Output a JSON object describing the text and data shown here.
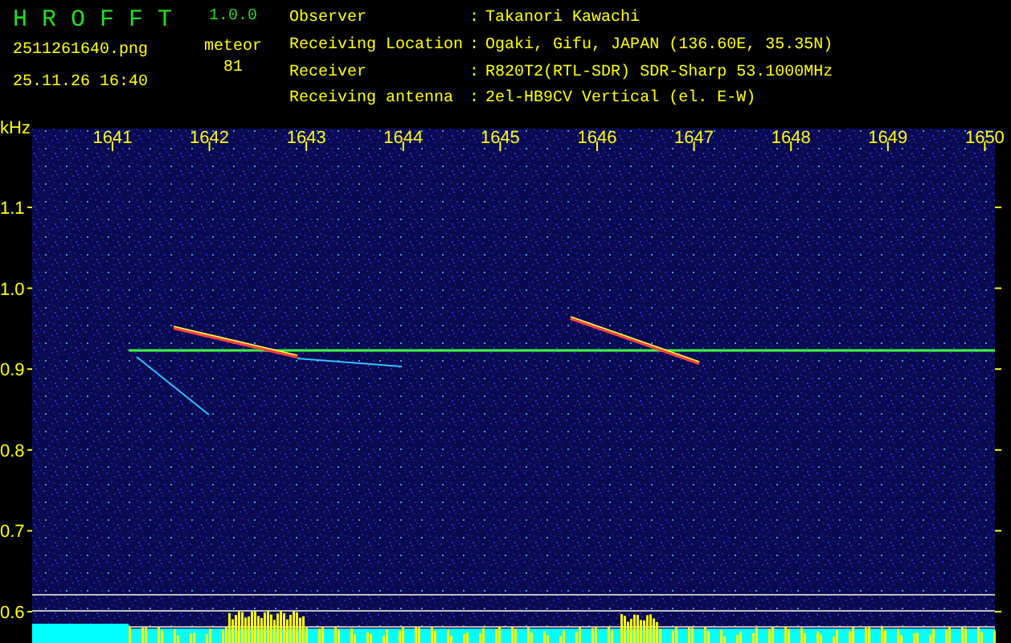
{
  "app": {
    "title": "H R O F F T",
    "version": "1.0.0",
    "filename": "2511261640.png",
    "datetime": "25.11.26 16:40",
    "count_label": "meteor",
    "count": "81"
  },
  "info": [
    {
      "label": "Observer",
      "value": "Takanori Kawachi"
    },
    {
      "label": "Receiving Location",
      "value": "Ogaki, Gifu, JAPAN (136.60E, 35.35N)"
    },
    {
      "label": "Receiver",
      "value": "R820T2(RTL-SDR) SDR-Sharp 53.1000MHz"
    },
    {
      "label": "Receiving antenna",
      "value": "2el-HB9CV Vertical (el. E-W)"
    }
  ],
  "separator": ":",
  "spectrogram": {
    "y_unit": "kHz",
    "x_ticks": [
      "1641",
      "1642",
      "1643",
      "1644",
      "1645",
      "1646",
      "1647",
      "1648",
      "1649",
      "1650"
    ],
    "y_ticks": [
      "1.1",
      "1.0",
      "0.9",
      "0.8",
      "0.7",
      "0.6"
    ]
  }
}
